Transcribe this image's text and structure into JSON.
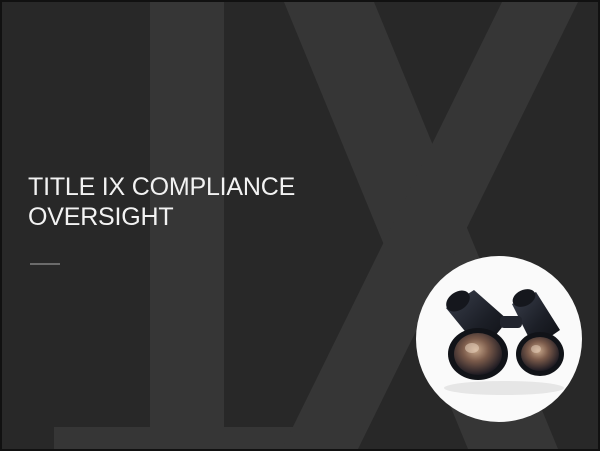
{
  "slide": {
    "title_line1": "TITLE IX COMPLIANCE",
    "title_line2": "OVERSIGHT",
    "watermark_text": "IX",
    "image": {
      "icon": "binoculars-icon"
    }
  },
  "colors": {
    "background": "#282828",
    "watermark": "#363636",
    "title_text": "#f2f2f2",
    "divider": "#6b6b6b",
    "image_circle": "#fafafa"
  }
}
